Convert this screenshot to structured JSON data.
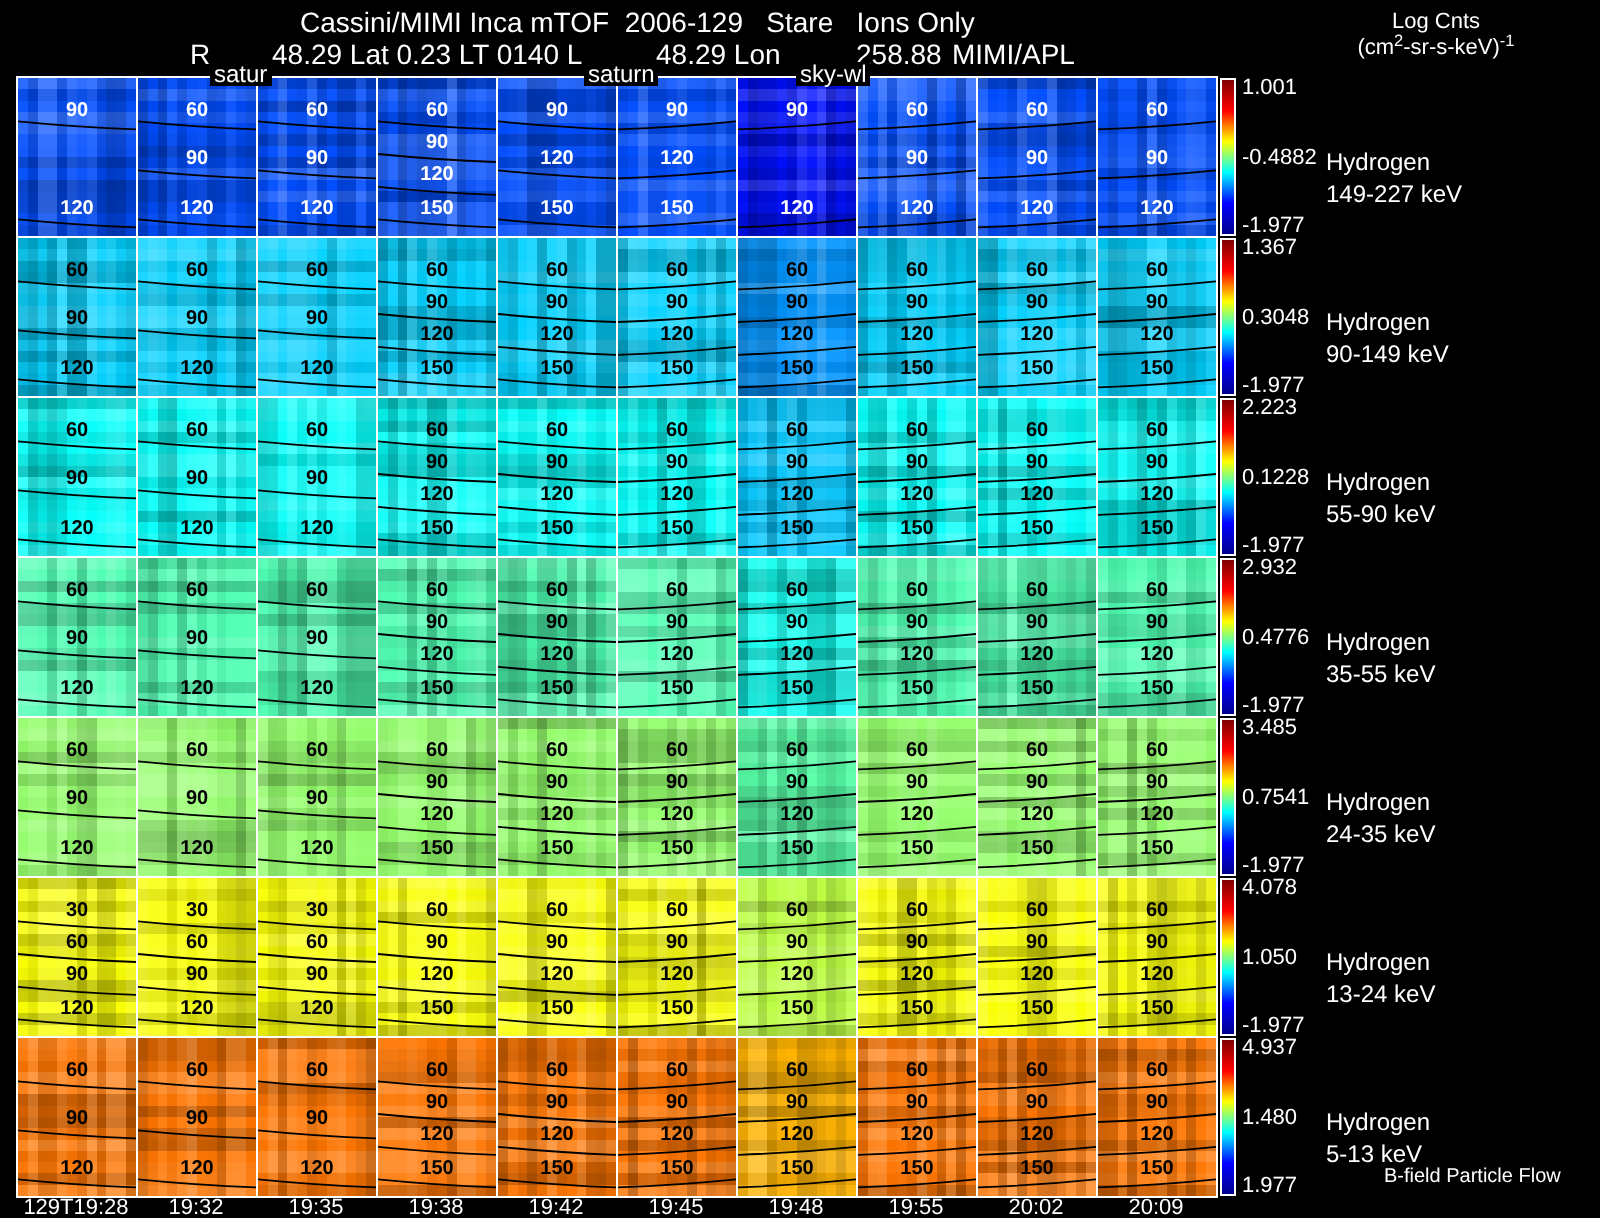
{
  "title": "Cassini/MIMI Inca mTOF  2006-129   Stare   Ions Only",
  "position_line": [
    "R",
    "48.29 Lat 0.23 LT 0140 L",
    "48.29 Lon",
    "258.88",
    "MIMI/APL"
  ],
  "units": {
    "label": "Log Cnts",
    "unit": "(cm$^{2}$-sr-s-keV)$^{-1}$"
  },
  "overlay_labels": [
    "satur",
    "saturn",
    "sky-wl"
  ],
  "rows": [
    {
      "species": "Hydrogen",
      "energy": "149-227 keV",
      "scale": [
        "1.001",
        "-0.4882",
        "-1.977"
      ],
      "panels": [
        [
          "90",
          "120"
        ],
        [
          "60",
          "90",
          "120"
        ],
        [
          "60",
          "90",
          "120"
        ],
        [
          "60",
          "90",
          "120",
          "150"
        ],
        [
          "90",
          "120",
          "150"
        ],
        [
          "90",
          "120",
          "150"
        ],
        [
          "90",
          "120"
        ],
        [
          "60",
          "90",
          "120"
        ],
        [
          "60",
          "90",
          "120"
        ],
        [
          "60",
          "90",
          "120"
        ]
      ]
    },
    {
      "species": "Hydrogen",
      "energy": "90-149 keV",
      "scale": [
        "1.367",
        "0.3048",
        "-1.977"
      ],
      "panels": [
        [
          "60",
          "90",
          "120"
        ],
        [
          "60",
          "90",
          "120"
        ],
        [
          "60",
          "90",
          "120"
        ],
        [
          "60",
          "90",
          "120",
          "150"
        ],
        [
          "60",
          "90",
          "120",
          "150"
        ],
        [
          "60",
          "90",
          "120",
          "150"
        ],
        [
          "60",
          "90",
          "120",
          "150"
        ],
        [
          "60",
          "90",
          "120",
          "150"
        ],
        [
          "60",
          "90",
          "120",
          "150"
        ],
        [
          "60",
          "90",
          "120",
          "150"
        ]
      ]
    },
    {
      "species": "Hydrogen",
      "energy": "55-90 keV",
      "scale": [
        "2.223",
        "0.1228",
        "-1.977"
      ],
      "panels": [
        [
          "60",
          "90",
          "120"
        ],
        [
          "60",
          "90",
          "120"
        ],
        [
          "60",
          "90",
          "120"
        ],
        [
          "60",
          "90",
          "120",
          "150"
        ],
        [
          "60",
          "90",
          "120",
          "150"
        ],
        [
          "60",
          "90",
          "120",
          "150"
        ],
        [
          "60",
          "90",
          "120",
          "150"
        ],
        [
          "60",
          "90",
          "120",
          "150"
        ],
        [
          "60",
          "90",
          "120",
          "150"
        ],
        [
          "60",
          "90",
          "120",
          "150"
        ]
      ]
    },
    {
      "species": "Hydrogen",
      "energy": "35-55 keV",
      "scale": [
        "2.932",
        "0.4776",
        "-1.977"
      ],
      "panels": [
        [
          "60",
          "90",
          "120"
        ],
        [
          "60",
          "90",
          "120"
        ],
        [
          "60",
          "90",
          "120"
        ],
        [
          "60",
          "90",
          "120",
          "150"
        ],
        [
          "60",
          "90",
          "120",
          "150"
        ],
        [
          "60",
          "90",
          "120",
          "150"
        ],
        [
          "60",
          "90",
          "120",
          "150"
        ],
        [
          "60",
          "90",
          "120",
          "150"
        ],
        [
          "60",
          "90",
          "120",
          "150"
        ],
        [
          "60",
          "90",
          "120",
          "150"
        ]
      ]
    },
    {
      "species": "Hydrogen",
      "energy": "24-35 keV",
      "scale": [
        "3.485",
        "0.7541",
        "-1.977"
      ],
      "panels": [
        [
          "60",
          "90",
          "120"
        ],
        [
          "60",
          "90",
          "120"
        ],
        [
          "60",
          "90",
          "120"
        ],
        [
          "60",
          "90",
          "120",
          "150"
        ],
        [
          "60",
          "90",
          "120",
          "150"
        ],
        [
          "60",
          "90",
          "120",
          "150"
        ],
        [
          "60",
          "90",
          "120",
          "150"
        ],
        [
          "60",
          "90",
          "120",
          "150"
        ],
        [
          "60",
          "90",
          "120",
          "150"
        ],
        [
          "60",
          "90",
          "120",
          "150"
        ]
      ]
    },
    {
      "species": "Hydrogen",
      "energy": "13-24 keV",
      "scale": [
        "4.078",
        "1.050",
        "-1.977"
      ],
      "panels": [
        [
          "30",
          "60",
          "90",
          "120"
        ],
        [
          "30",
          "60",
          "90",
          "120"
        ],
        [
          "30",
          "60",
          "90",
          "120"
        ],
        [
          "60",
          "90",
          "120",
          "150"
        ],
        [
          "60",
          "90",
          "120",
          "150"
        ],
        [
          "60",
          "90",
          "120",
          "150"
        ],
        [
          "60",
          "90",
          "120",
          "150"
        ],
        [
          "60",
          "90",
          "120",
          "150"
        ],
        [
          "60",
          "90",
          "120",
          "150"
        ],
        [
          "60",
          "90",
          "120",
          "150"
        ]
      ]
    },
    {
      "species": "Hydrogen",
      "energy": "5-13 keV",
      "scale": [
        "4.937",
        "1.480",
        "1.977"
      ],
      "panels": [
        [
          "60",
          "90",
          "120"
        ],
        [
          "60",
          "90",
          "120"
        ],
        [
          "60",
          "90",
          "120"
        ],
        [
          "60",
          "90",
          "120",
          "150"
        ],
        [
          "60",
          "90",
          "120",
          "150"
        ],
        [
          "60",
          "90",
          "120",
          "150"
        ],
        [
          "60",
          "90",
          "120",
          "150"
        ],
        [
          "60",
          "90",
          "120",
          "150"
        ],
        [
          "60",
          "90",
          "120",
          "150"
        ],
        [
          "60",
          "90",
          "120",
          "150"
        ]
      ]
    }
  ],
  "footnote": "B-field Particle Flow",
  "times": [
    "129T19:28",
    "19:32",
    "19:35",
    "19:38",
    "19:42",
    "19:45",
    "19:48",
    "19:55",
    "20:02",
    "20:09"
  ]
}
